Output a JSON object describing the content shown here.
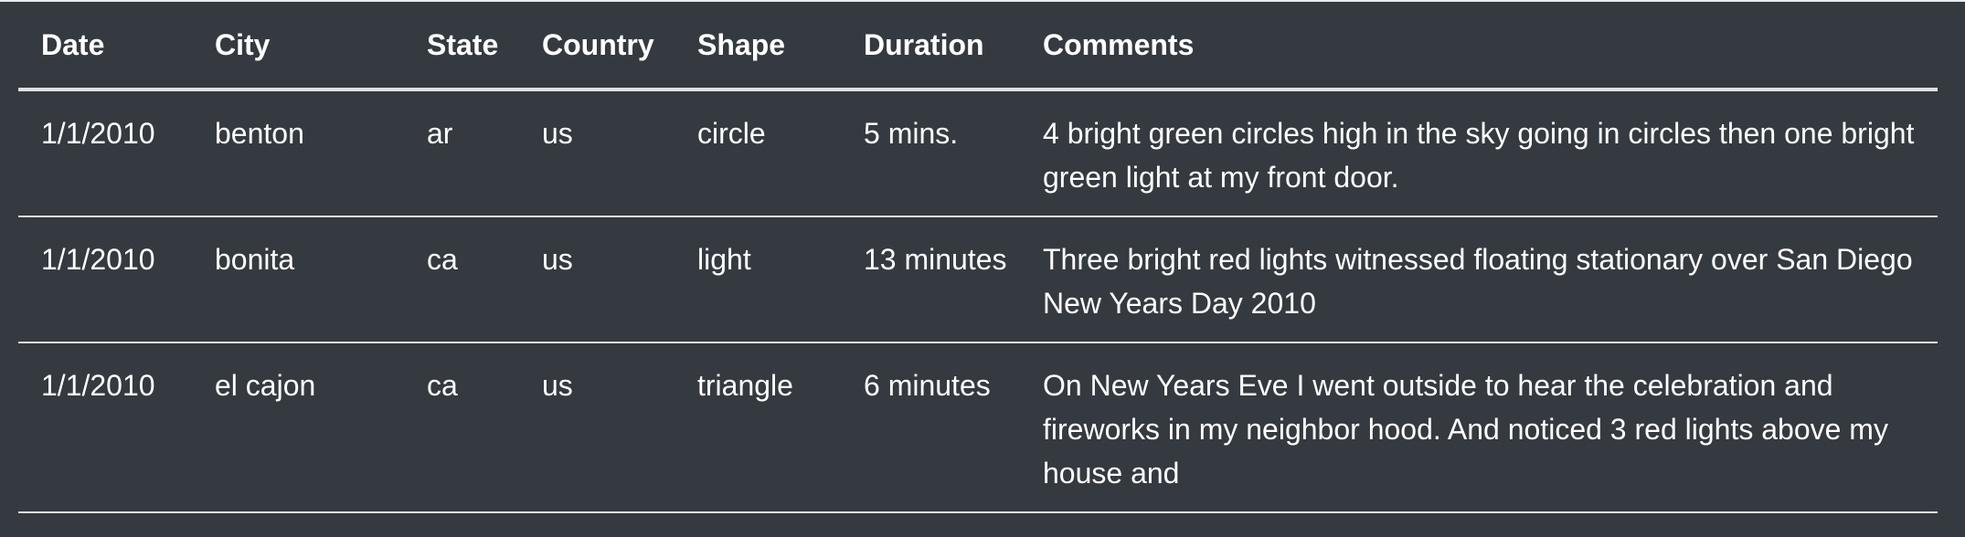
{
  "table": {
    "columns": [
      "Date",
      "City",
      "State",
      "Country",
      "Shape",
      "Duration",
      "Comments"
    ],
    "rows": [
      {
        "date": "1/1/2010",
        "city": "benton",
        "state": "ar",
        "country": "us",
        "shape": "circle",
        "duration": "5 mins.",
        "comments": "4 bright green circles high in the sky going in circles then one bright green light at my front door."
      },
      {
        "date": "1/1/2010",
        "city": "bonita",
        "state": "ca",
        "country": "us",
        "shape": "light",
        "duration": "13 minutes",
        "comments": "Three bright red lights witnessed floating stationary over San Diego New Years Day 2010"
      },
      {
        "date": "1/1/2010",
        "city": "el cajon",
        "state": "ca",
        "country": "us",
        "shape": "triangle",
        "duration": "6 minutes",
        "comments": "On New Years Eve I went outside to hear the celebration and fireworks in my neighbor hood. And noticed 3 red lights above my house and"
      }
    ]
  },
  "colors": {
    "background": "#343a40",
    "text": "#ffffff",
    "border": "#dee2e6"
  }
}
